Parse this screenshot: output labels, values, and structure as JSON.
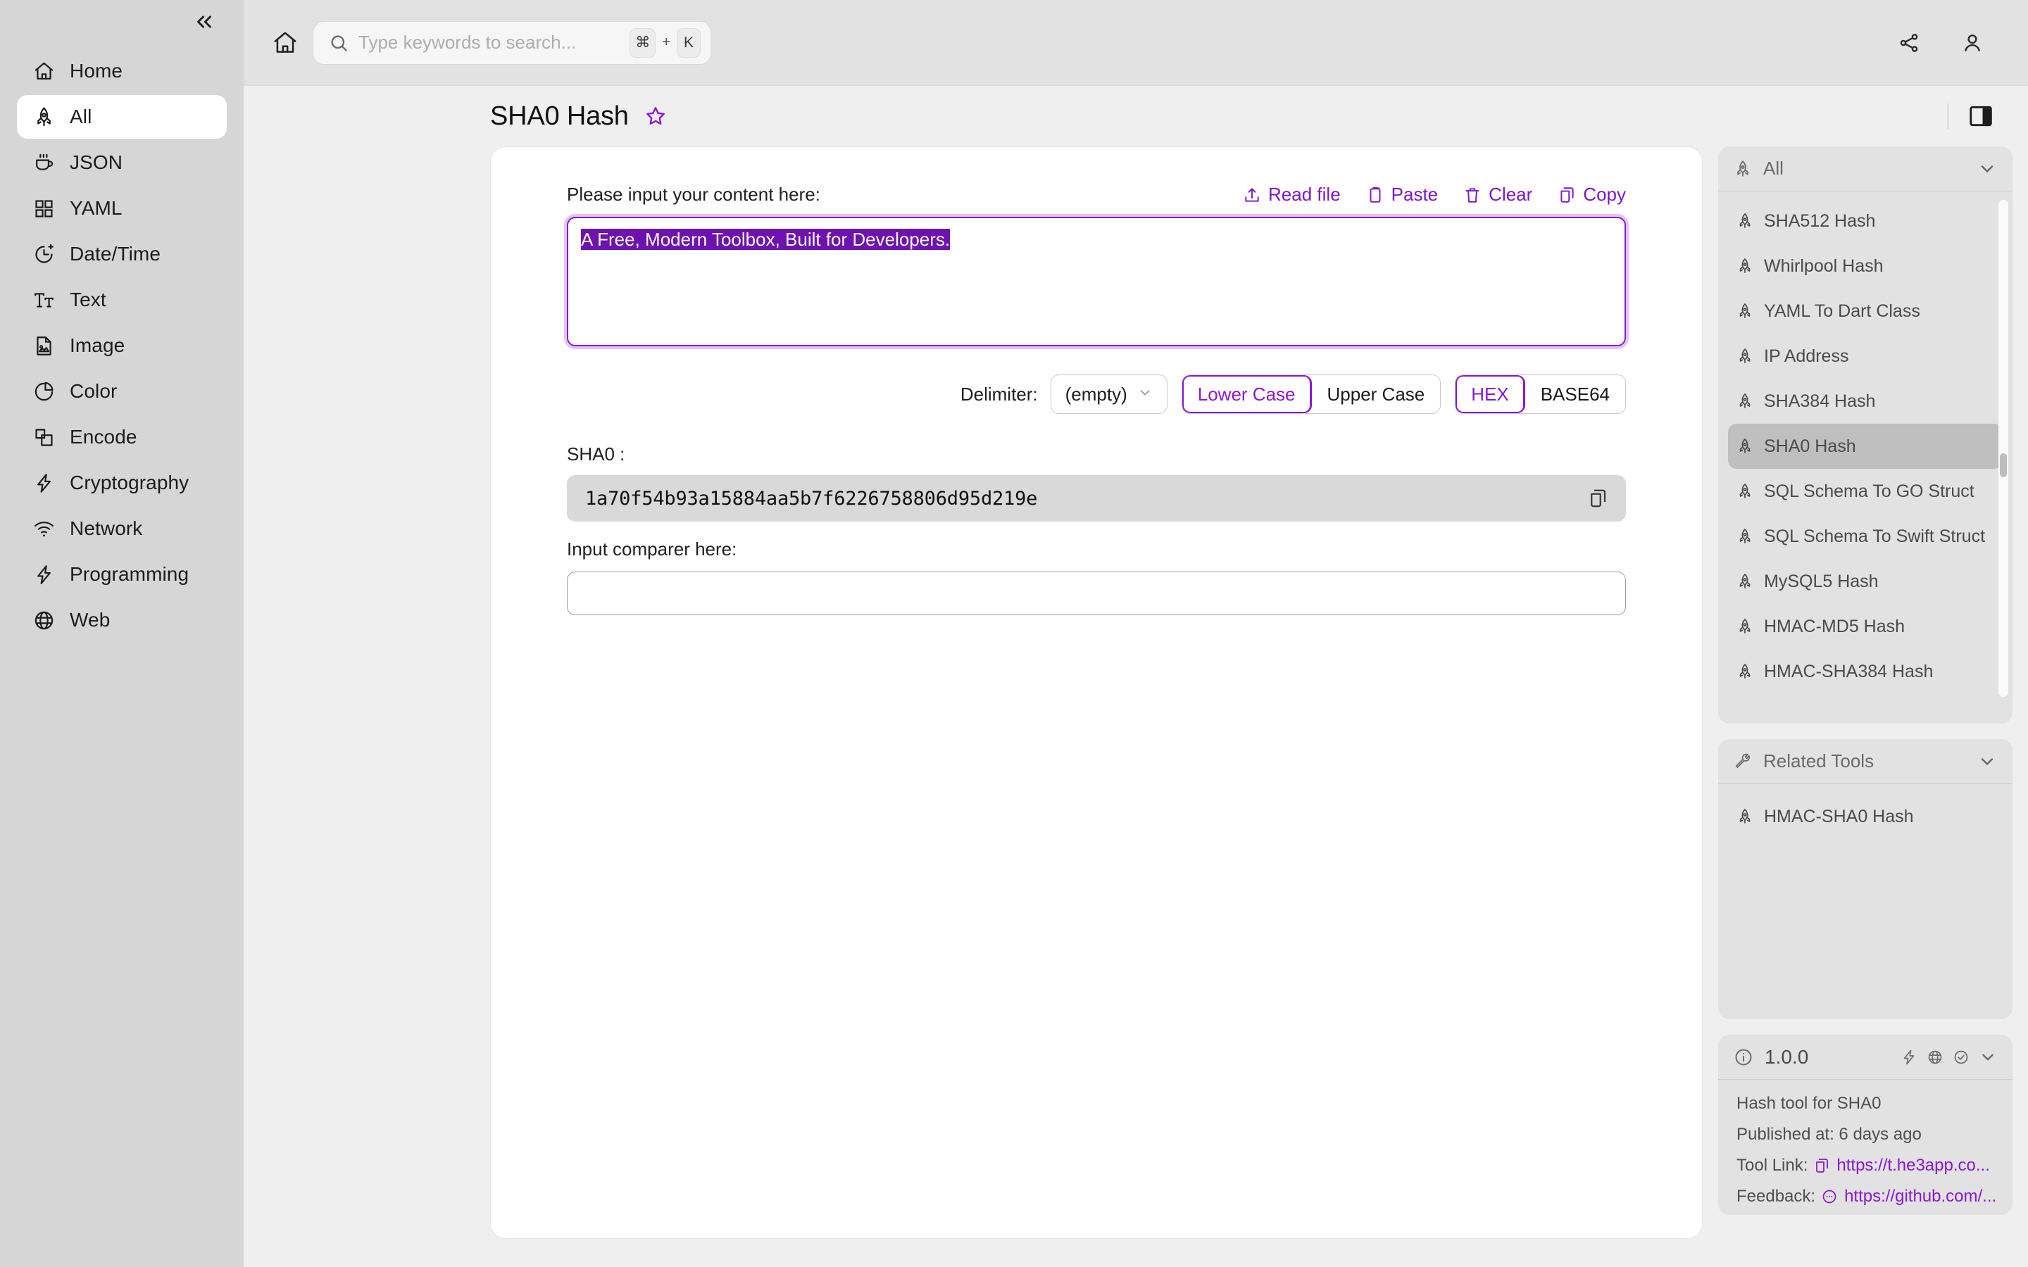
{
  "sidebar": {
    "collapse_icon": "chevrons-left-icon",
    "items": [
      {
        "label": "Home",
        "icon": "home-icon",
        "active": false
      },
      {
        "label": "All",
        "icon": "rocket-icon",
        "active": true
      },
      {
        "label": "JSON",
        "icon": "coffee-icon",
        "active": false
      },
      {
        "label": "YAML",
        "icon": "grid-icon",
        "active": false
      },
      {
        "label": "Date/Time",
        "icon": "clock-icon",
        "active": false
      },
      {
        "label": "Text",
        "icon": "text-icon",
        "active": false
      },
      {
        "label": "Image",
        "icon": "image-icon",
        "active": false
      },
      {
        "label": "Color",
        "icon": "pie-chart-icon",
        "active": false
      },
      {
        "label": "Encode",
        "icon": "layers-icon",
        "active": false
      },
      {
        "label": "Cryptography",
        "icon": "bolt-icon",
        "active": false
      },
      {
        "label": "Network",
        "icon": "wifi-icon",
        "active": false
      },
      {
        "label": "Programming",
        "icon": "bolt-icon",
        "active": false
      },
      {
        "label": "Web",
        "icon": "globe-icon",
        "active": false
      }
    ]
  },
  "topbar": {
    "home_icon": "home-icon",
    "search": {
      "placeholder": "Type keywords to search...",
      "value": "",
      "icon": "search-icon",
      "kbd_mod": "⌘",
      "kbd_plus": "+",
      "kbd_key": "K"
    },
    "share_icon": "share-icon",
    "account_icon": "user-icon"
  },
  "page": {
    "title": "SHA0 Hash",
    "favorite_icon": "star-icon",
    "panel_toggle_icon": "right-panel-icon"
  },
  "tool": {
    "input_label": "Please input your content here:",
    "actions": [
      {
        "label": "Read file",
        "icon": "upload-icon"
      },
      {
        "label": "Paste",
        "icon": "clipboard-icon"
      },
      {
        "label": "Clear",
        "icon": "trash-icon"
      },
      {
        "label": "Copy",
        "icon": "copy-icon"
      }
    ],
    "input_value": "A Free, Modern Toolbox, Built for Developers.",
    "input_selected": true,
    "delimiter_label": "Delimiter:",
    "delimiter_value": "(empty)",
    "delimiter_chevron": "chevron-down-icon",
    "case_options": [
      {
        "label": "Lower Case",
        "active": true
      },
      {
        "label": "Upper Case",
        "active": false
      }
    ],
    "encoding_options": [
      {
        "label": "HEX",
        "active": true
      },
      {
        "label": "BASE64",
        "active": false
      }
    ],
    "result_label": "SHA0 :",
    "result_value": "1a70f54b93a15884aa5b7f6226758806d95d219e",
    "result_copy_icon": "copy-icon",
    "comparer_label": "Input comparer here:",
    "comparer_value": "",
    "comparer_placeholder": ""
  },
  "rail": {
    "all_panel": {
      "title": "All",
      "icon": "rocket-icon",
      "chevron": "chevron-down-icon",
      "items": [
        {
          "label": "SHA512 Hash",
          "active": false
        },
        {
          "label": "Whirlpool Hash",
          "active": false
        },
        {
          "label": "YAML To Dart Class",
          "active": false
        },
        {
          "label": "IP Address",
          "active": false
        },
        {
          "label": "SHA384 Hash",
          "active": false
        },
        {
          "label": "SHA0 Hash",
          "active": true
        },
        {
          "label": "SQL Schema To GO Struct",
          "active": false
        },
        {
          "label": "SQL Schema To Swift Struct",
          "active": false
        },
        {
          "label": "MySQL5 Hash",
          "active": false
        },
        {
          "label": "HMAC-MD5 Hash",
          "active": false
        },
        {
          "label": "HMAC-SHA384 Hash",
          "active": false
        }
      ]
    },
    "related_panel": {
      "title": "Related Tools",
      "icon": "wrench-icon",
      "chevron": "chevron-down-icon",
      "items": [
        {
          "label": "HMAC-SHA0 Hash",
          "active": false
        }
      ]
    },
    "info_panel": {
      "icon": "info-icon",
      "version": "1.0.0",
      "head_icons": [
        "bolt-icon",
        "globe-icon",
        "check-circle-icon",
        "chevron-down-icon"
      ],
      "description": "Hash tool for SHA0",
      "published": "Published at: 6 days ago",
      "tool_link_label": "Tool Link:",
      "tool_link_icon": "copy-icon",
      "tool_link_value": "https://t.he3app.co...",
      "feedback_label": "Feedback:",
      "feedback_icon": "message-icon",
      "feedback_value": "https://github.com/..."
    }
  },
  "colors": {
    "accent": "#8a17d4",
    "selection": "#6d11b0",
    "sidebar_bg": "#d6d6d6",
    "panel_bg": "#e2e2e2",
    "page_bg": "#efefef",
    "card_bg": "#ffffff",
    "result_bg": "#d9d9d9"
  }
}
